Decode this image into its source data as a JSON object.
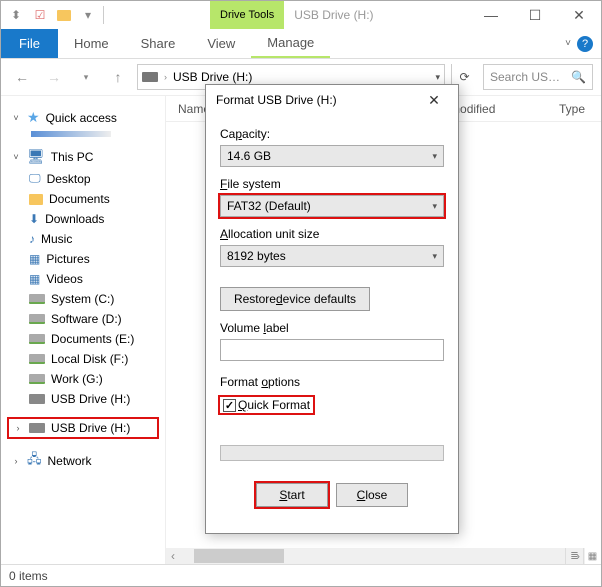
{
  "window": {
    "drive_tools_tab": "Drive Tools",
    "title": "USB Drive (H:)"
  },
  "ribbon": {
    "file": "File",
    "tabs": [
      "Home",
      "Share",
      "View",
      "Manage"
    ]
  },
  "addressbar": {
    "crumb": "USB Drive (H:)"
  },
  "search": {
    "placeholder": "Search US…"
  },
  "columns": {
    "name": "Name",
    "modified": "e modified",
    "type": "Type"
  },
  "nav": {
    "quick_access": "Quick access",
    "this_pc": "This PC",
    "desktop": "Desktop",
    "documents": "Documents",
    "downloads": "Downloads",
    "music": "Music",
    "pictures": "Pictures",
    "videos": "Videos",
    "system": "System (C:)",
    "software": "Software (D:)",
    "documents_e": "Documents (E:)",
    "local_f": "Local Disk (F:)",
    "work_g": "Work (G:)",
    "usb_h1": "USB Drive (H:)",
    "usb_h2": "USB Drive (H:)",
    "network": "Network"
  },
  "status": {
    "items": "0 items"
  },
  "dialog": {
    "title": "Format USB Drive (H:)",
    "capacity_label": "Capacity:",
    "capacity_value": "14.6 GB",
    "fs_label": "File system",
    "fs_value": "FAT32 (Default)",
    "alloc_label": "Allocation unit size",
    "alloc_value": "8192 bytes",
    "restore": "Restore device defaults",
    "vol_label": "Volume label",
    "vol_value": "",
    "fmt_options": "Format options",
    "quick_checked": true,
    "quick_label": "Quick Format",
    "start": "Start",
    "close": "Close"
  }
}
